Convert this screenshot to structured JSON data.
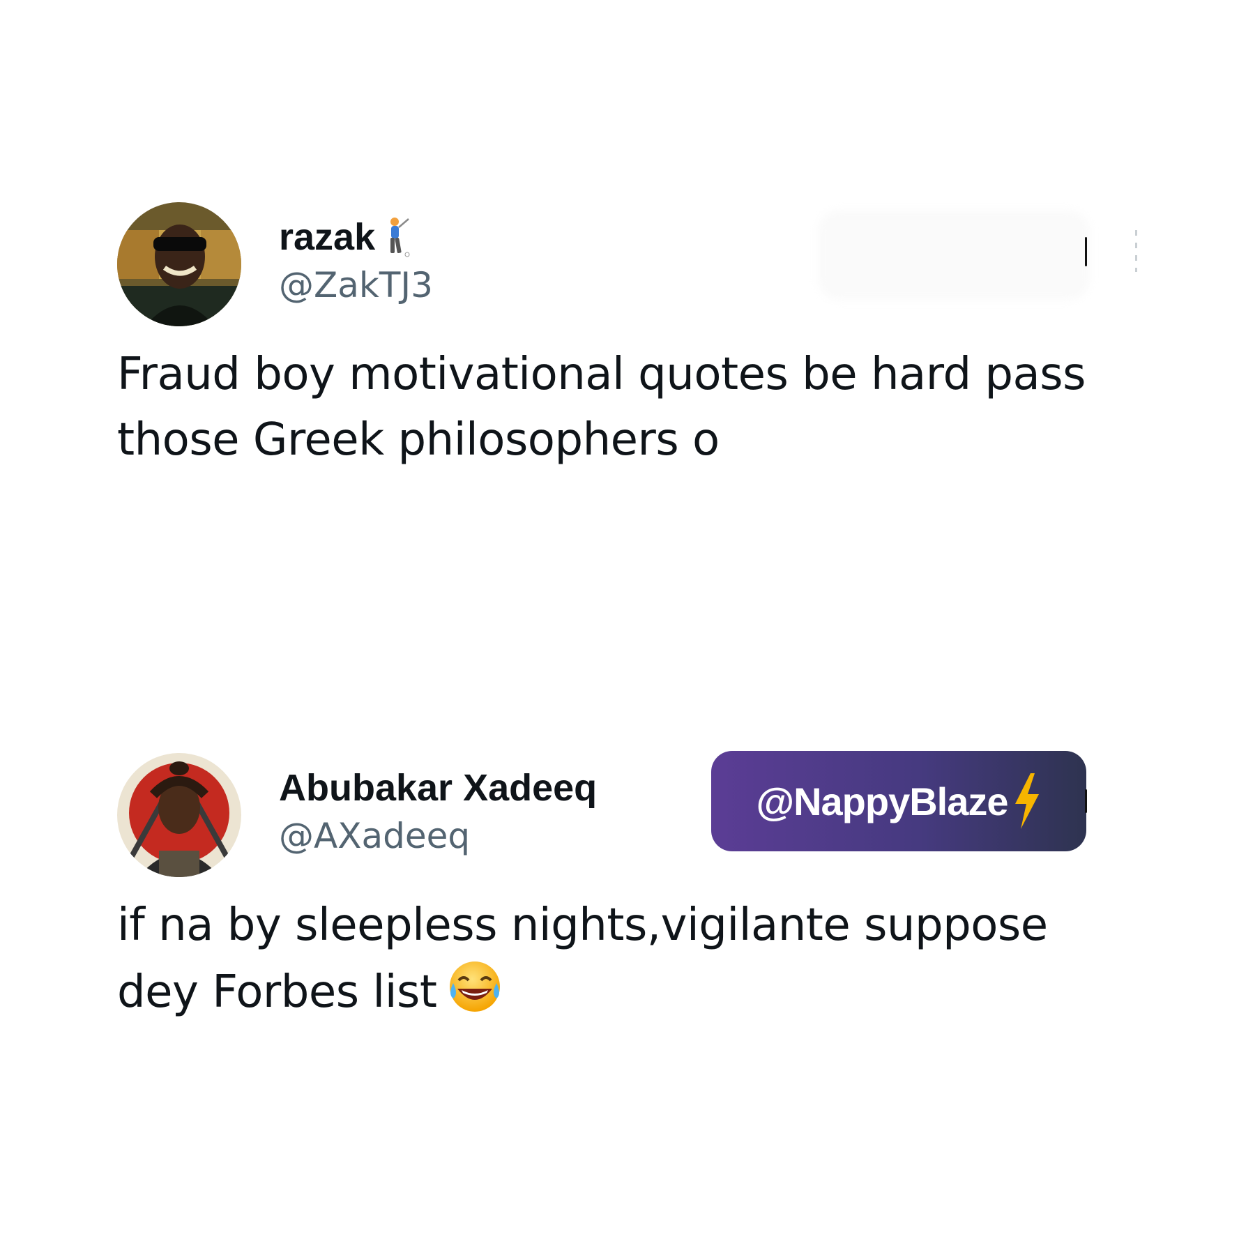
{
  "tweets": [
    {
      "display_name": "razak",
      "name_emoji": "golfer-emoji",
      "handle": "@ZakTJ3",
      "text_lines": [
        "Fraud boy motivational quotes be hard pass",
        "those Greek philosophers o"
      ]
    },
    {
      "display_name": "Abubakar Xadeeq",
      "handle": "@AXadeeq",
      "text_lines": [
        "if na by sleepless nights,vigilante suppose",
        "dey Forbes list"
      ],
      "trailing_emoji": "face-with-tears-of-joy-emoji"
    }
  ],
  "watermark": {
    "text": "@NappyBlaze",
    "icon": "lightning-bolt-icon"
  },
  "colors": {
    "text_primary": "#0f1419",
    "text_secondary": "#536471",
    "watermark_gradient_start": "#5b3d95",
    "watermark_gradient_end": "#2e3350",
    "bolt": "#f7b500"
  }
}
